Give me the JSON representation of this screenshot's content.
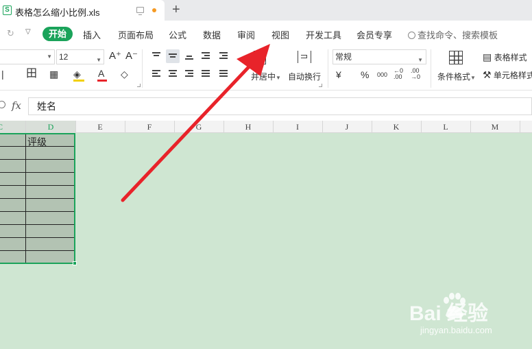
{
  "tab": {
    "filename": "表格怎么缩小比例.xls",
    "app_badge": "S"
  },
  "menu": {
    "items": [
      "开始",
      "插入",
      "页面布局",
      "公式",
      "数据",
      "审阅",
      "视图",
      "开发工具",
      "会员专享"
    ],
    "search_placeholder": "查找命令、搜索模板"
  },
  "ribbon": {
    "font_size": "12",
    "number_format": "常规",
    "merge_label": "并居中",
    "wrap_label": "自动换行",
    "cond_format_label": "条件格式",
    "table_style_label": "表格样式",
    "cell_format_label": "单元格样式",
    "grow_font": "A⁺",
    "shrink_font": "A⁻",
    "currency": "¥",
    "percent": "%",
    "thousands": "000",
    "dec_inc": "←0 .00",
    "dec_dec": ".00 →0"
  },
  "formula_bar": {
    "fx": "fx",
    "value": "姓名"
  },
  "columns": [
    "C",
    "D",
    "E",
    "F",
    "G",
    "H",
    "I",
    "J",
    "K",
    "L",
    "M"
  ],
  "cells": {
    "d1": "评级"
  },
  "watermark": {
    "brand": "Bai 经验",
    "url": "jingyan.baidu.com"
  },
  "colors": {
    "accent": "#1aa35a",
    "sheet_bg": "#cfe6d2",
    "arrow": "#e8232a"
  }
}
